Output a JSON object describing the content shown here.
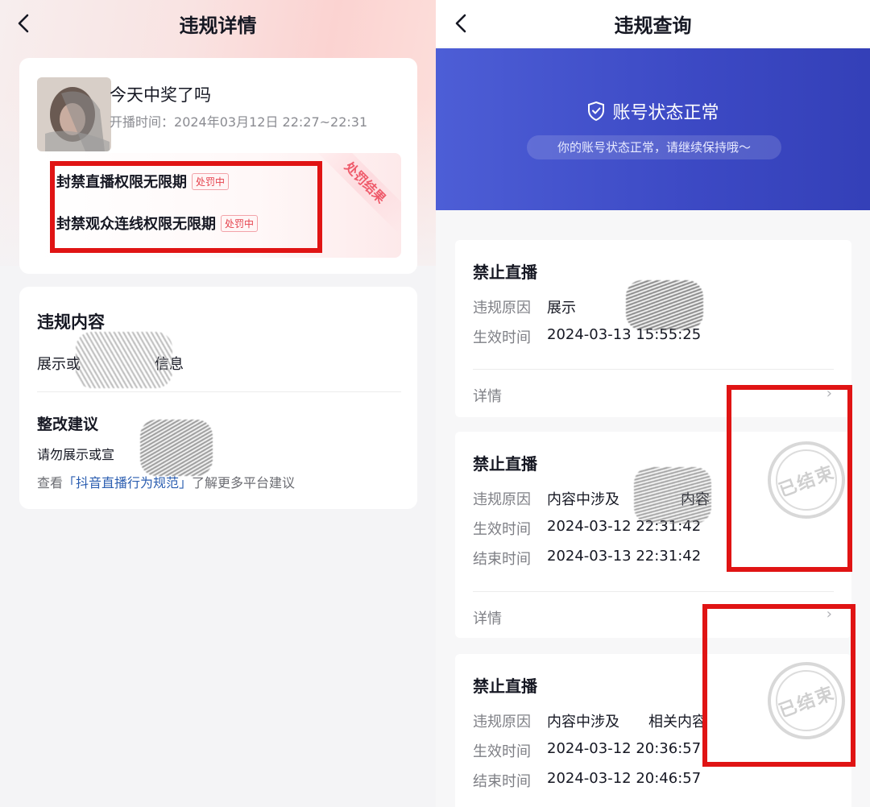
{
  "left": {
    "nav": {
      "title": "违规详情"
    },
    "live": {
      "title": "今天中奖了吗",
      "time_label": "开播时间：",
      "time_value": "2024年03月12日 22:27~22:31",
      "ribbon": "处罚结果",
      "penalties": [
        {
          "name": "封禁直播权限无限期",
          "tag": "处罚中"
        },
        {
          "name": "封禁观众连线权限无限期",
          "tag": "处罚中"
        }
      ]
    },
    "violation": {
      "heading": "违规内容",
      "text": "展示或",
      "text_tail": "信息",
      "advice_heading": "整改建议",
      "advice_text": "请勿展示或宣",
      "more_prefix": "查看",
      "more_link": "「抖音直播行为规范」",
      "more_suffix": "了解更多平台建议"
    }
  },
  "right": {
    "nav": {
      "title": "违规查询"
    },
    "status": {
      "title": "账号状态正常",
      "subtitle": "你的账号状态正常，请继续保持哦～"
    },
    "records": [
      {
        "title": "禁止直播",
        "reason_label": "违规原因",
        "reason_value": "展示",
        "start_label": "生效时间",
        "start_value": "2024-03-13 15:55:25",
        "detail_label": "详情"
      },
      {
        "title": "禁止直播",
        "reason_label": "违规原因",
        "reason_value": "内容中涉及",
        "reason_tail": "内容",
        "start_label": "生效时间",
        "start_value": "2024-03-12 22:31:42",
        "end_label": "结束时间",
        "end_value": "2024-03-13 22:31:42",
        "detail_label": "详情",
        "stamp": "已结束"
      },
      {
        "title": "禁止直播",
        "reason_label": "违规原因",
        "reason_value": "内容中涉及",
        "reason_tail": "相关内容",
        "start_label": "生效时间",
        "start_value": "2024-03-12 20:36:57",
        "end_label": "结束时间",
        "end_value": "2024-03-12 20:46:57",
        "stamp": "已结束"
      }
    ]
  },
  "colors": {
    "accent_red": "#e01414",
    "banner_blue": "#3c49c4",
    "tag_red": "#e5424d",
    "link_blue": "#2a5db0"
  }
}
